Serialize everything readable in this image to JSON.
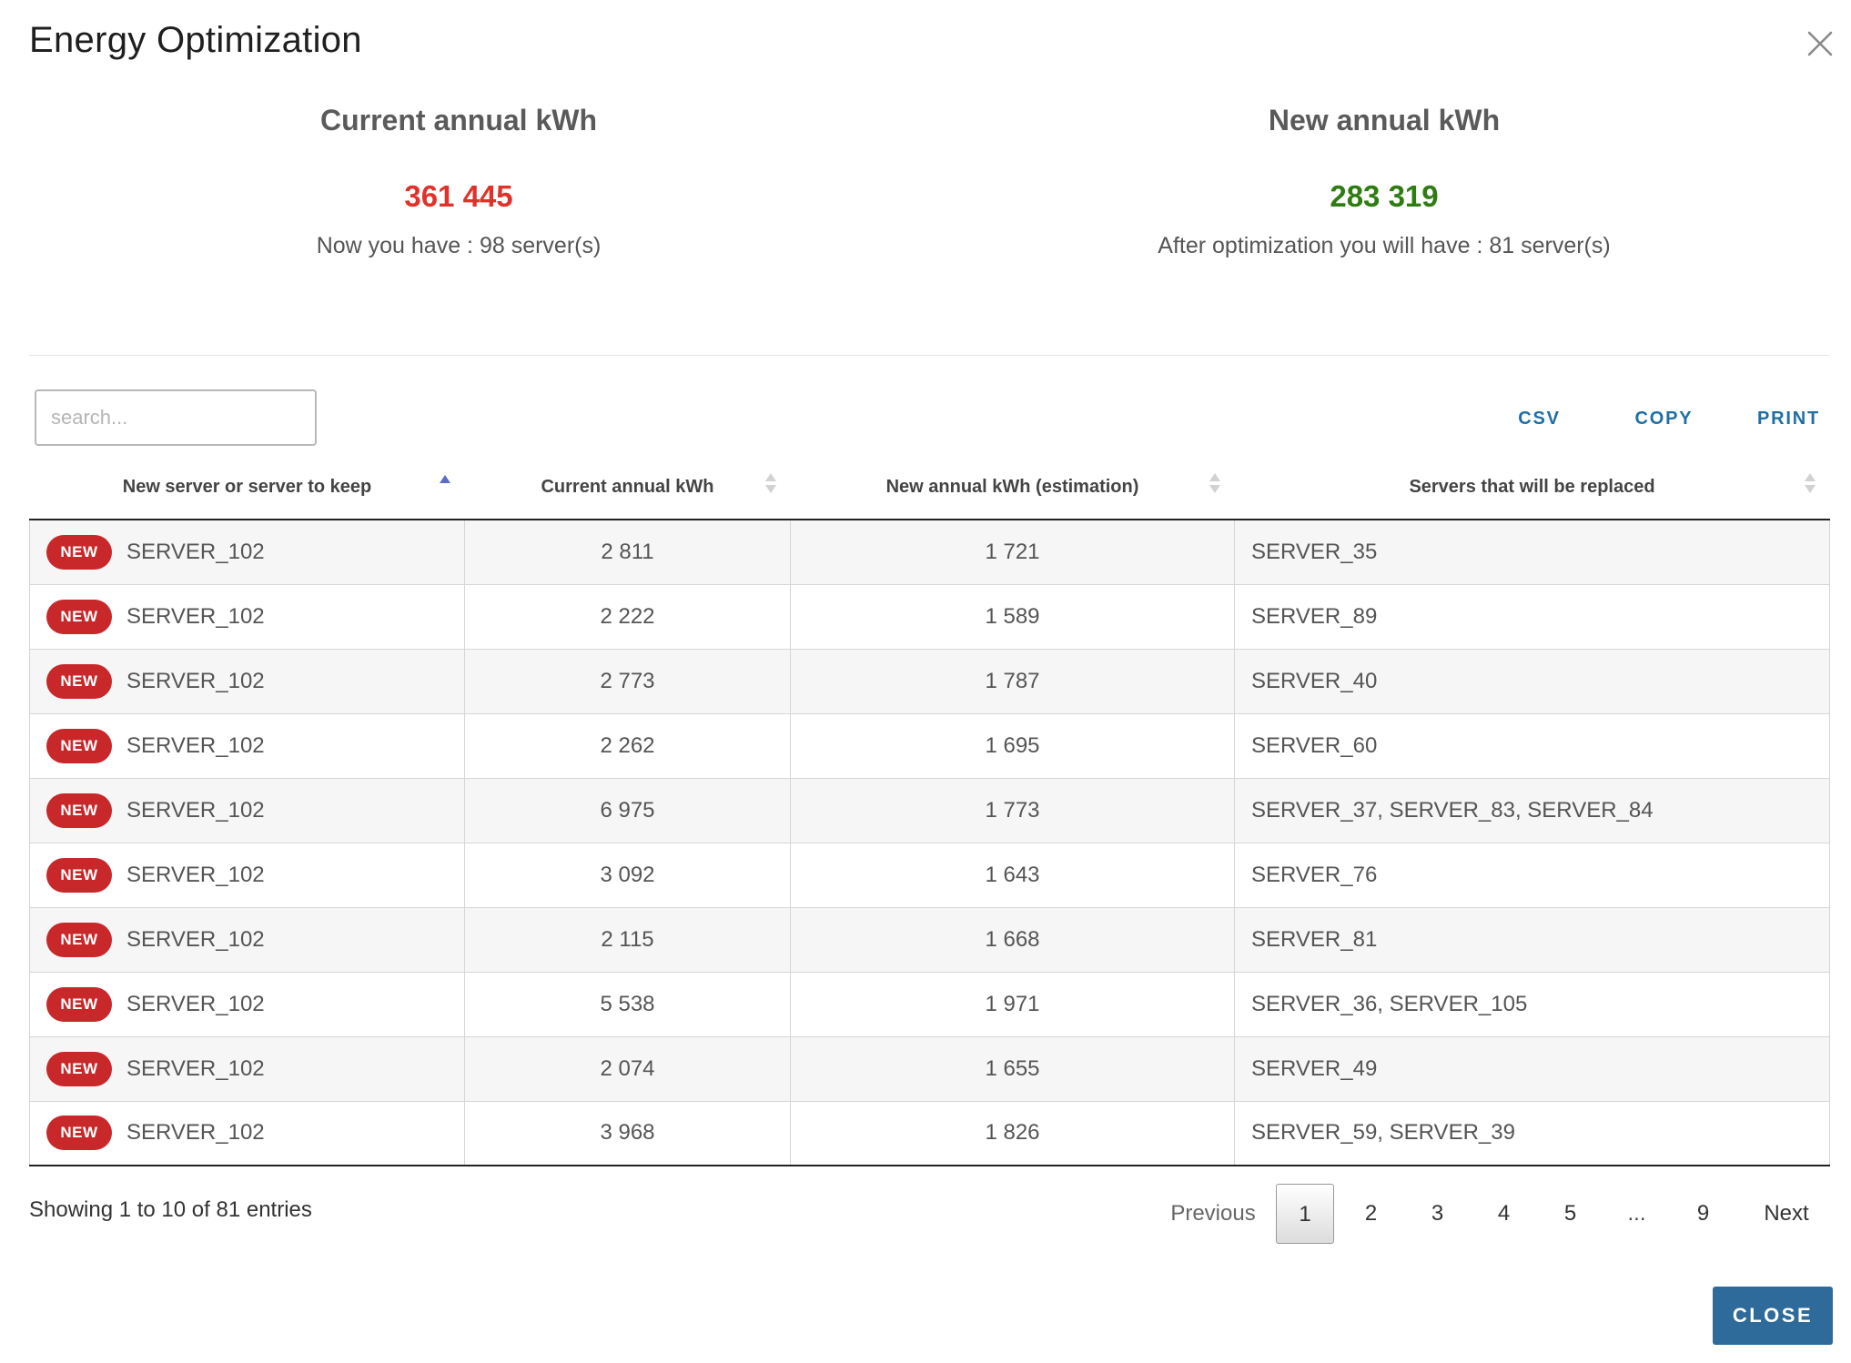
{
  "modal": {
    "title": "Energy Optimization",
    "close_icon": "close-icon"
  },
  "summary": {
    "current": {
      "heading": "Current annual kWh",
      "value": "361 445",
      "subtext": "Now you have : 98 server(s)",
      "value_color": "#e0322b"
    },
    "new": {
      "heading": "New annual kWh",
      "value": "283 319",
      "subtext": "After optimization you will have : 81 server(s)",
      "value_color": "#2f7d12"
    }
  },
  "search": {
    "placeholder": "search...",
    "value": ""
  },
  "export": {
    "csv": "CSV",
    "copy": "COPY",
    "print": "PRINT"
  },
  "table": {
    "columns": [
      {
        "label": "New server or server to keep",
        "sort": "asc"
      },
      {
        "label": "Current annual kWh",
        "sort": "none"
      },
      {
        "label": "New annual kWh (estimation)",
        "sort": "none"
      },
      {
        "label": "Servers that will be replaced",
        "sort": "none"
      }
    ],
    "badge_label": "NEW",
    "rows": [
      {
        "server": "SERVER_102",
        "current": "2 811",
        "new": "1 721",
        "replaced": "SERVER_35"
      },
      {
        "server": "SERVER_102",
        "current": "2 222",
        "new": "1 589",
        "replaced": "SERVER_89"
      },
      {
        "server": "SERVER_102",
        "current": "2 773",
        "new": "1 787",
        "replaced": "SERVER_40"
      },
      {
        "server": "SERVER_102",
        "current": "2 262",
        "new": "1 695",
        "replaced": "SERVER_60"
      },
      {
        "server": "SERVER_102",
        "current": "6 975",
        "new": "1 773",
        "replaced": "SERVER_37, SERVER_83, SERVER_84"
      },
      {
        "server": "SERVER_102",
        "current": "3 092",
        "new": "1 643",
        "replaced": "SERVER_76"
      },
      {
        "server": "SERVER_102",
        "current": "2 115",
        "new": "1 668",
        "replaced": "SERVER_81"
      },
      {
        "server": "SERVER_102",
        "current": "5 538",
        "new": "1 971",
        "replaced": "SERVER_36, SERVER_105"
      },
      {
        "server": "SERVER_102",
        "current": "2 074",
        "new": "1 655",
        "replaced": "SERVER_49"
      },
      {
        "server": "SERVER_102",
        "current": "3 968",
        "new": "1 826",
        "replaced": "SERVER_59, SERVER_39"
      }
    ]
  },
  "footer": {
    "info": "Showing 1 to 10 of 81 entries"
  },
  "pagination": {
    "previous": "Previous",
    "next": "Next",
    "ellipsis": "...",
    "current_page": "1",
    "pages": [
      "1",
      "2",
      "3",
      "4",
      "5",
      "...",
      "9"
    ]
  },
  "close_button": {
    "label": "CLOSE",
    "color": "#2e6a9a"
  }
}
